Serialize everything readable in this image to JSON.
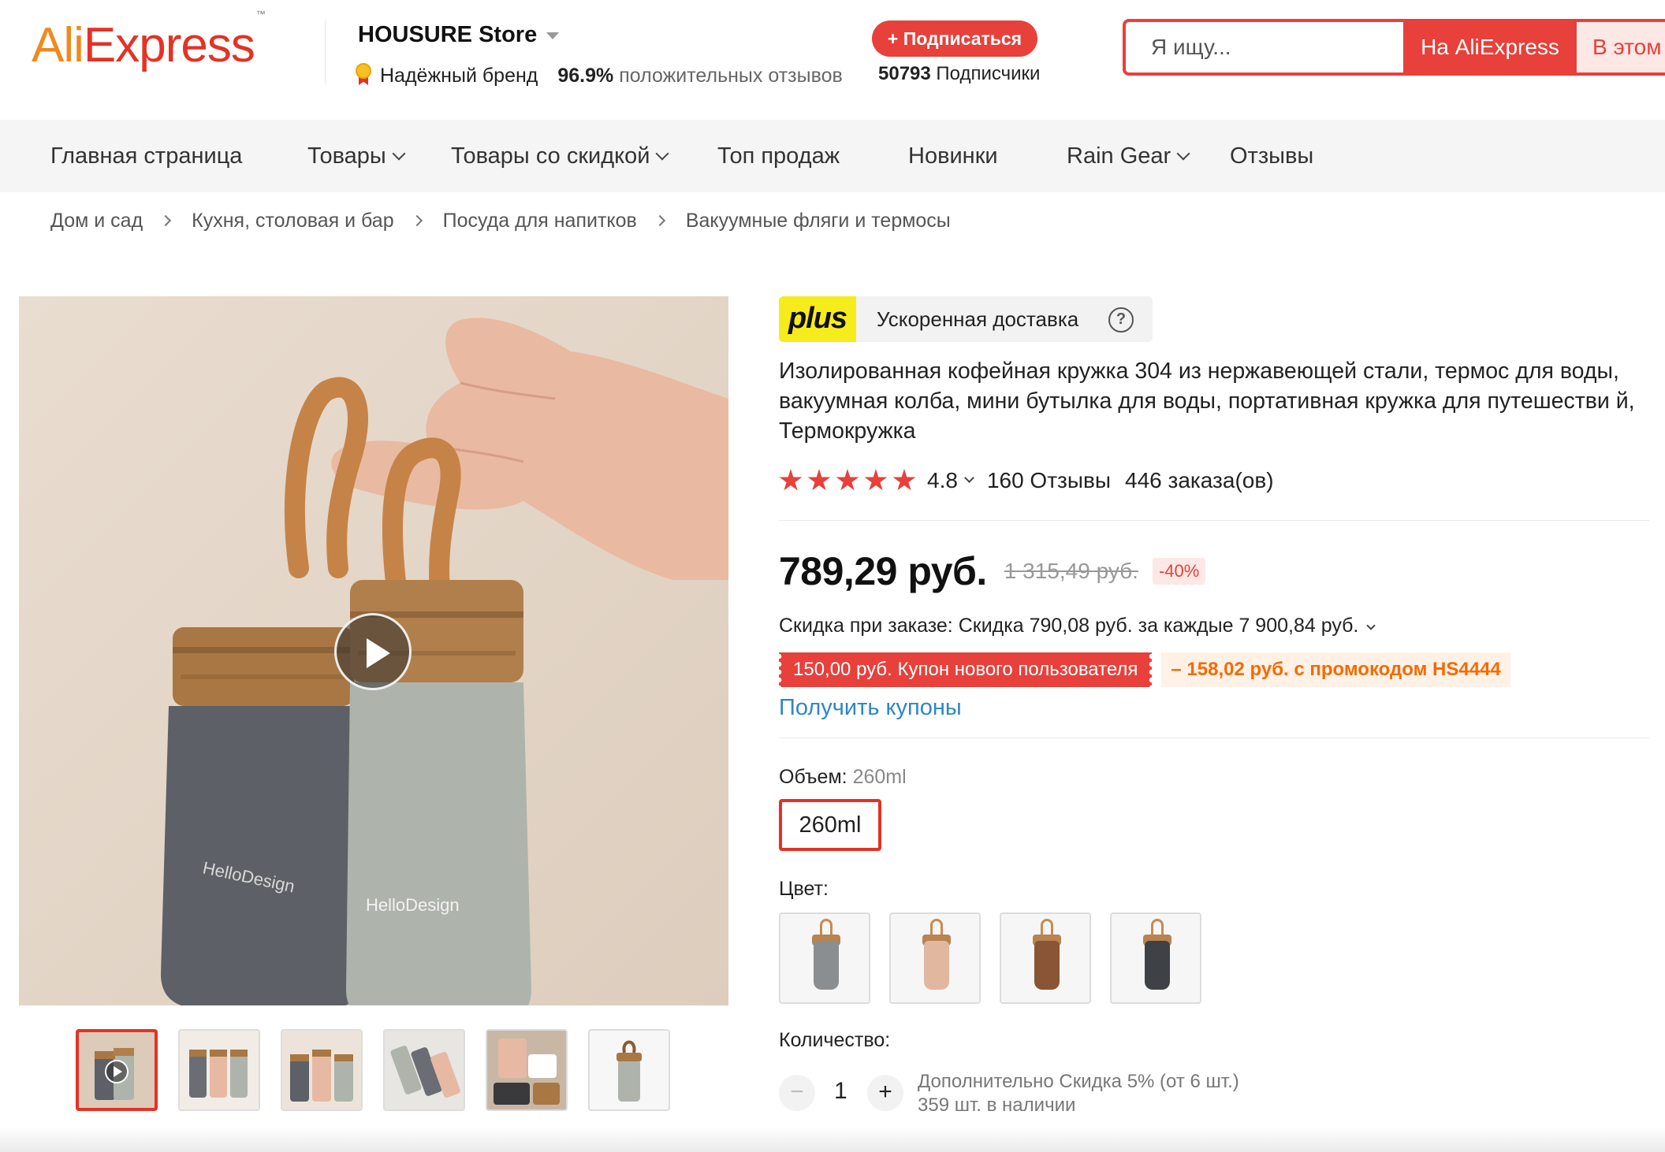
{
  "header": {
    "logo_ali": "Ali",
    "logo_express": "Express",
    "logo_tm": "™",
    "store_name": "HOUSURE Store",
    "trust_label": "Надёжный бренд",
    "positive_pct": "96.9%",
    "positive_text": "положительных отзывов",
    "subscribe_label": "+ Подписаться",
    "subscribers_count": "50793",
    "subscribers_label": "Подписчики",
    "search_placeholder": "Я ищу...",
    "search_ali_label": "На AliExpress",
    "search_store_label": "В этом"
  },
  "nav": {
    "items": [
      {
        "label": "Главная страница",
        "dropdown": false
      },
      {
        "label": "Товары",
        "dropdown": true
      },
      {
        "label": "Товары со скидкой",
        "dropdown": true
      },
      {
        "label": "Топ продаж",
        "dropdown": false
      },
      {
        "label": "Новинки",
        "dropdown": false
      },
      {
        "label": "Rain Gear",
        "dropdown": true
      },
      {
        "label": "Отзывы",
        "dropdown": false
      }
    ]
  },
  "breadcrumb": [
    "Дом и сад",
    "Кухня, столовая и бар",
    "Посуда для напитков",
    "Вакуумные фляги и термосы"
  ],
  "gallery": {
    "video_icon": "play-icon",
    "thumbnail_count": 6,
    "active_thumbnail": 1
  },
  "product": {
    "plus_logo": "plus",
    "plus_text": "Ускоренная доставка",
    "help_glyph": "?",
    "title": "Изолированная кофейная кружка 304 из нержавеющей стали, термос для воды, вакуумная колба, мини бутылка для воды, портативная кружка для путешестви й, Термокружка",
    "rating": "4.8",
    "stars": 5,
    "reviews": "160 Отзывы",
    "orders": "446 заказа(ов)",
    "price": "789,29 руб.",
    "old_price": "1 315,49 руб.",
    "discount": "-40%",
    "promo_label": "Скидка при заказе:",
    "promo_text": "Скидка 790,08 руб. за каждые 7 900,84 руб.",
    "coupon_new_user": "150,00 руб. Купон нового пользователя",
    "coupon_code": "– 158,02 руб. с промокодом HS4444",
    "get_coupons": "Получить купоны",
    "volume_label": "Объем:",
    "volume_value": "260ml",
    "volume_option": "260ml",
    "color_label": "Цвет:",
    "color_options": [
      "gray",
      "pink",
      "brown",
      "black"
    ],
    "quantity_label": "Количество:",
    "qty_minus": "−",
    "qty_value": "1",
    "qty_plus": "+",
    "qty_discount": "Дополнительно Скидка 5% (от 6 шт.)",
    "stock": "359 шт. в наличии"
  },
  "colors": {
    "accent": "#e8403a",
    "logo_orange": "#f08a1c",
    "link": "#2e86c8",
    "plus_yellow": "#f6ec1c"
  }
}
